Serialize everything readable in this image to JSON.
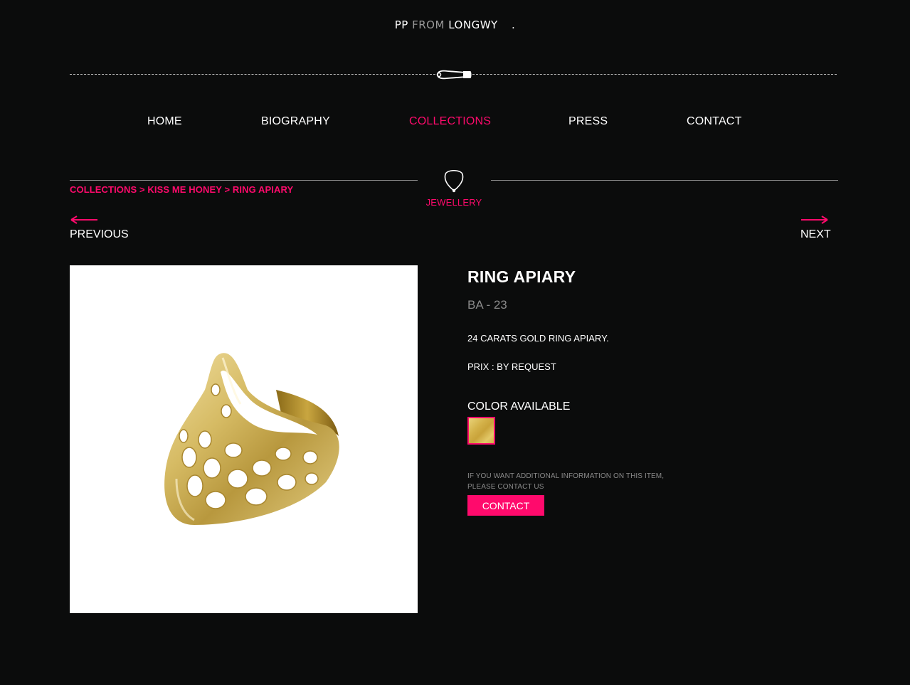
{
  "logo": {
    "pp": "PP",
    "from": "FROM",
    "longwy": "LONGWY",
    "dot": "."
  },
  "nav": {
    "items": [
      {
        "label": "HOME"
      },
      {
        "label": "BIOGRAPHY"
      },
      {
        "label": "COLLECTIONS"
      },
      {
        "label": "PRESS"
      },
      {
        "label": "CONTACT"
      }
    ],
    "active": "COLLECTIONS"
  },
  "breadcrumb": {
    "items": [
      "COLLECTIONS",
      "KISS ME HONEY",
      "RING APIARY"
    ],
    "separator": ">"
  },
  "section": {
    "label": "JEWELLERY",
    "icon": "pendant-icon"
  },
  "pager": {
    "previous": "PREVIOUS",
    "next": "NEXT"
  },
  "product": {
    "title": "RING APIARY",
    "reference": "BA - 23",
    "description": "24 CARATS GOLD RING APIARY.",
    "price": "PRIX : BY REQUEST",
    "color_label": "COLOR AVAILABLE",
    "colors": [
      {
        "name": "gold",
        "hex": "#d4b24a"
      }
    ],
    "info_line1": "IF YOU WANT ADDITIONAL INFORMATION ON THIS ITEM,",
    "info_line2": "PLEASE CONTACT US",
    "contact_label": "CONTACT"
  },
  "colors": {
    "accent": "#ff0a6c",
    "background": "#0b0c0c",
    "muted": "#8a8a8a"
  }
}
